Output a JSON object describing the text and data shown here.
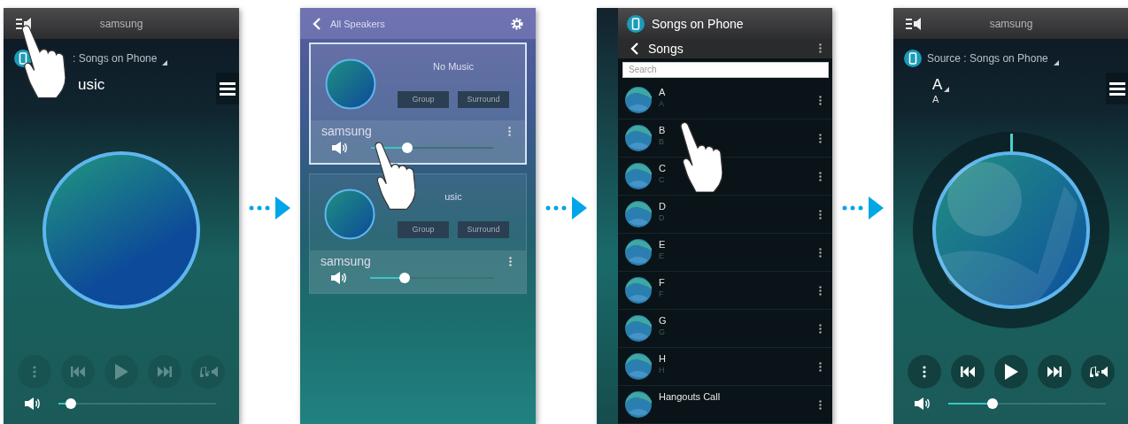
{
  "screens": [
    {
      "kind": "player",
      "touch": true,
      "header_title": "samsung",
      "source": ": Songs on Phone",
      "title": "usic",
      "title_caret": false,
      "controls_disabled": true,
      "volume": {
        "level": 0.08
      }
    },
    {
      "kind": "speakers",
      "touch": true,
      "header_title": "All Speakers",
      "cards": [
        {
          "selected": true,
          "status": "No Music",
          "buttons": [
            "Group",
            "Surround"
          ],
          "name": "samsung",
          "level": 0.3
        },
        {
          "selected": false,
          "status": "usic",
          "buttons": [
            "Group",
            "Surround"
          ],
          "name": "samsung",
          "level": 0.28
        }
      ]
    },
    {
      "kind": "songs",
      "touch": true,
      "header_title": "Songs on Phone",
      "list_title": "Songs",
      "search": {
        "placeholder": "Search"
      },
      "songs": [
        {
          "title": "A",
          "artist": "A"
        },
        {
          "title": "B",
          "artist": "B"
        },
        {
          "title": "C",
          "artist": "C"
        },
        {
          "title": "D",
          "artist": "D"
        },
        {
          "title": "E",
          "artist": "E"
        },
        {
          "title": "F",
          "artist": "F"
        },
        {
          "title": "G",
          "artist": "G"
        },
        {
          "title": "H",
          "artist": "H"
        },
        {
          "title": "Hangouts Call"
        }
      ]
    },
    {
      "kind": "player",
      "touch": false,
      "header_title": "samsung",
      "source": "Source : Songs on Phone",
      "title": "A",
      "subtitle": "A",
      "title_caret": true,
      "controls_disabled": false,
      "volume": {
        "level": 0.28
      }
    }
  ]
}
